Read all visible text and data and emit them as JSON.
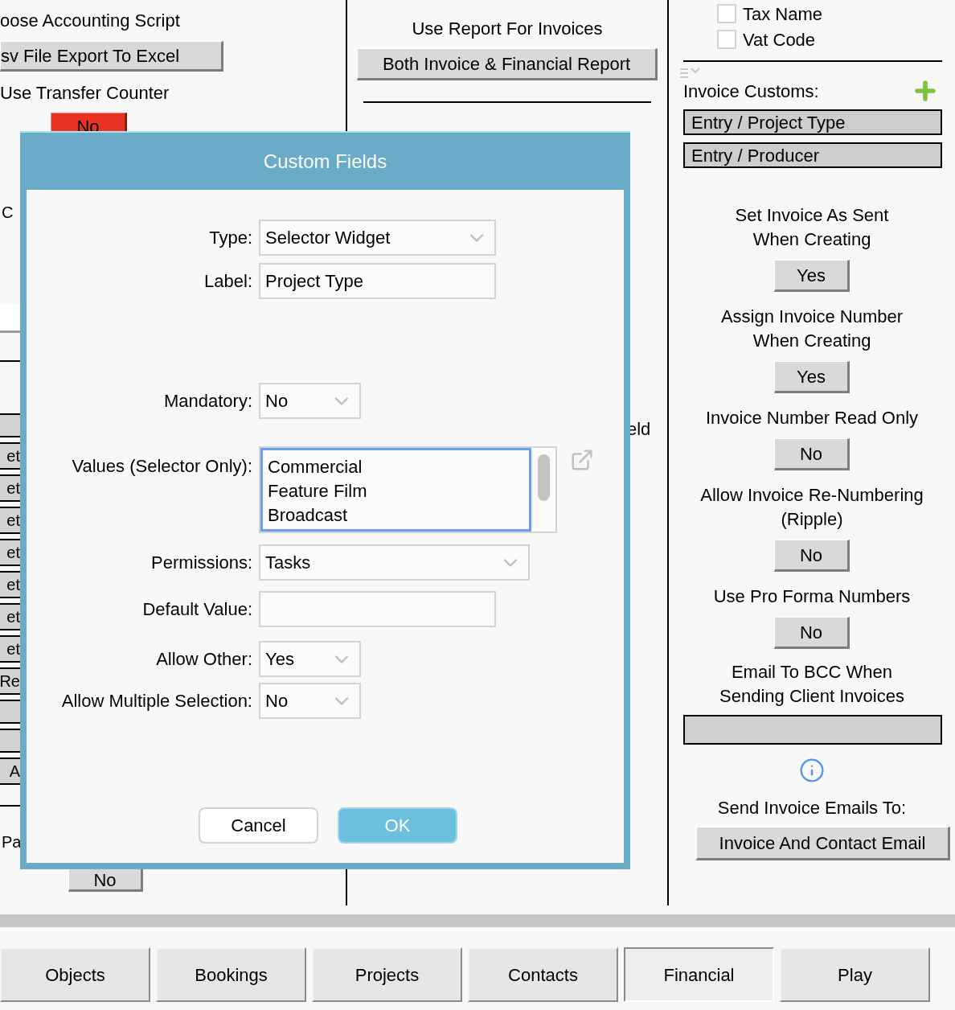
{
  "left_panel": {
    "script_label": "oose Accounting Script",
    "script_button": "sv File Export To Excel",
    "transfer_label": "Use Transfer Counter",
    "transfer_button": "No",
    "fragments": [
      {
        "kind": "text",
        "text": "C"
      },
      {
        "kind": "field"
      },
      {
        "kind": "rule"
      },
      {
        "kind": "blank"
      },
      {
        "kind": "button",
        "text": "et"
      },
      {
        "kind": "button",
        "text": "et"
      },
      {
        "kind": "button",
        "text": "et"
      },
      {
        "kind": "button",
        "text": "et"
      },
      {
        "kind": "button",
        "text": "et"
      },
      {
        "kind": "button",
        "text": "et"
      },
      {
        "kind": "button",
        "text": "et"
      },
      {
        "kind": "button",
        "text": "Re"
      },
      {
        "kind": "blank"
      },
      {
        "kind": "blank"
      },
      {
        "kind": "button",
        "text": "A"
      },
      {
        "kind": "rule"
      },
      {
        "kind": "text",
        "text": "Pa"
      }
    ],
    "bottom_button": "No"
  },
  "middle_panel": {
    "report_label": "Use Report For Invoices",
    "report_button": "Both Invoice & Financial Report",
    "field_fragment": "eld"
  },
  "right_panel": {
    "checkboxes": [
      {
        "label": "Tax Name",
        "checked": false
      },
      {
        "label": "Vat Code",
        "checked": false
      }
    ],
    "customs_label": "Invoice Customs:",
    "customs": [
      "Entry / Project Type",
      "Entry / Producer"
    ],
    "settings": [
      {
        "label": "Set Invoice As Sent\nWhen Creating",
        "value": "Yes"
      },
      {
        "label": "Assign Invoice Number\nWhen Creating",
        "value": "Yes"
      },
      {
        "label": "Invoice Number Read Only",
        "value": "No"
      },
      {
        "label": "Allow Invoice Re-Numbering\n(Ripple)",
        "value": "No"
      },
      {
        "label": "Use Pro Forma Numbers",
        "value": "No"
      }
    ],
    "bcc_label": "Email To BCC When\nSending Client Invoices",
    "send_label": "Send Invoice Emails To:",
    "send_button": "Invoice And Contact Email"
  },
  "dialog": {
    "title": "Custom Fields",
    "fields": [
      {
        "kind": "select",
        "label": "Type:",
        "value": "Selector Widget"
      },
      {
        "kind": "input",
        "label": "Label:",
        "value": "Project Type"
      },
      {
        "kind": "select",
        "label": "Mandatory:",
        "value": "No"
      },
      {
        "kind": "listbox",
        "label": "Values (Selector Only):",
        "options": [
          "Commercial",
          "Feature Film",
          "Broadcast"
        ]
      },
      {
        "kind": "select",
        "label": "Permissions:",
        "value": "Tasks"
      },
      {
        "kind": "input",
        "label": "Default Value:"
      },
      {
        "kind": "select",
        "label": "Allow Other:",
        "value": "Yes"
      },
      {
        "kind": "select",
        "label": "Allow Multiple Selection:",
        "value": "No"
      }
    ],
    "buttons": [
      {
        "label": "Cancel",
        "kind": "secondary"
      },
      {
        "label": "OK",
        "kind": "primary"
      }
    ]
  },
  "tabs": [
    {
      "label": "Objects",
      "selected": false
    },
    {
      "label": "Bookings",
      "selected": false
    },
    {
      "label": "Projects",
      "selected": false
    },
    {
      "label": "Contacts",
      "selected": false
    },
    {
      "label": "Financial",
      "selected": true
    },
    {
      "label": "Play",
      "selected": false
    }
  ]
}
